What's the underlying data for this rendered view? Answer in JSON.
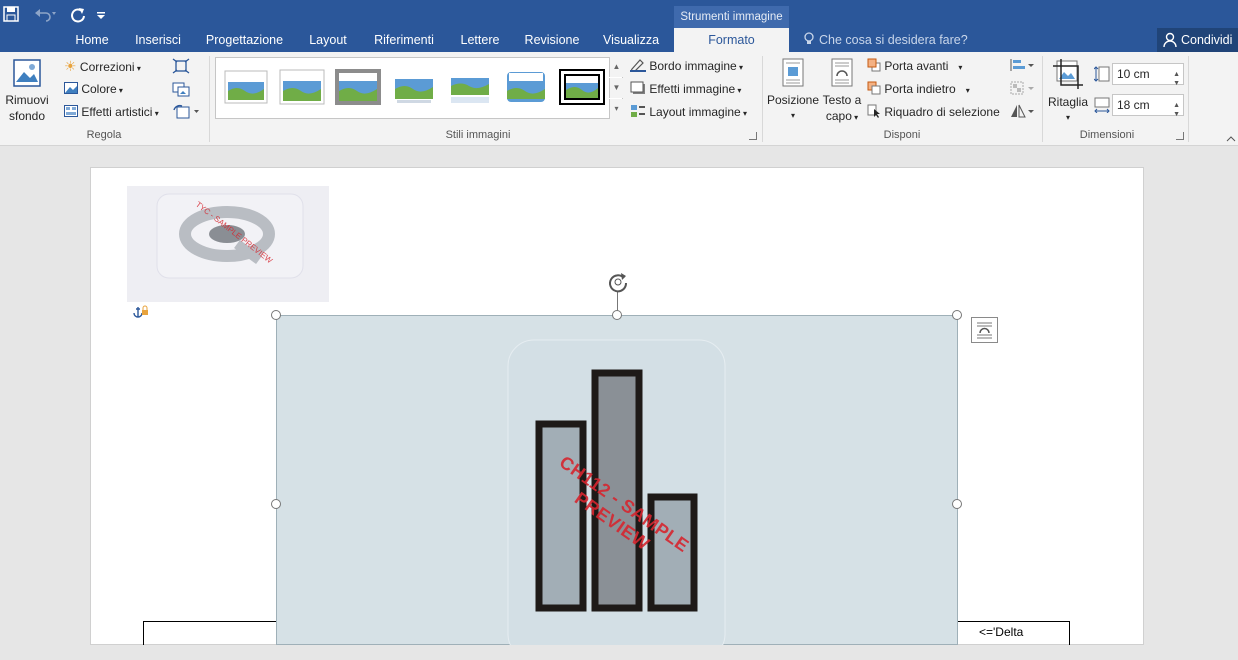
{
  "qat": {
    "save_icon": "save-icon",
    "undo_icon": "undo-icon",
    "redo_icon": "redo-icon",
    "customize_icon": "customize-qat-icon"
  },
  "context_group": "Strumenti immagine",
  "tabs": [
    "Home",
    "Inserisci",
    "Progettazione",
    "Layout",
    "Riferimenti",
    "Lettere",
    "Revisione",
    "Visualizza",
    "Formato"
  ],
  "active_tab": "Formato",
  "tellme": {
    "placeholder": "Che cosa si desidera fare?"
  },
  "share_label": "Condividi",
  "ribbon": {
    "regola": {
      "label": "Regola",
      "remove_bg_line1": "Rimuovi",
      "remove_bg_line2": "sfondo",
      "corrections": "Correzioni",
      "color": "Colore",
      "artistic_effects": "Effetti artistici"
    },
    "stili": {
      "label": "Stili immagini",
      "border": "Bordo immagine",
      "effects": "Effetti immagine",
      "layout": "Layout immagine"
    },
    "disponi": {
      "label": "Disponi",
      "position_line1": "Posizione",
      "wrap_line1": "Testo a",
      "wrap_line2": "capo",
      "bring_forward": "Porta avanti",
      "send_backward": "Porta indietro",
      "selection_pane": "Riquadro di selezione"
    },
    "dimensioni": {
      "label": "Dimensioni",
      "crop": "Ritaglia",
      "height": "10 cm",
      "width": "18 cm"
    }
  },
  "document": {
    "image_watermark": "CH112 - SAMPLE PREVIEW",
    "logo_watermark": "TYC - SAMPLE PREVIEW",
    "table_cell_text": "<='Delta"
  },
  "colors": {
    "accent": "#2b579a",
    "watermark": "#d6262f",
    "selected_image_bg": "#d6e1e6"
  }
}
